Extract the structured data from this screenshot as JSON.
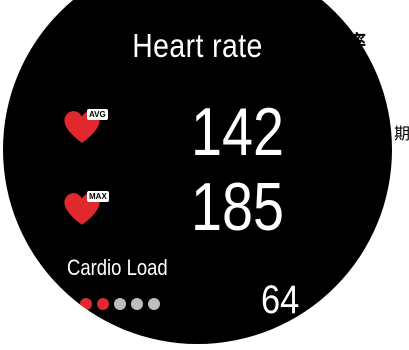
{
  "title": "Heart rate",
  "avg": {
    "tag": "AVG",
    "value": "142"
  },
  "max": {
    "tag": "MAX",
    "value": "185"
  },
  "cardio": {
    "label": "Cardio Load",
    "value": "64",
    "level": 2,
    "total": 5
  },
  "side_text": {
    "heart_rate_cn": "心率",
    "period_cn": "期"
  },
  "colors": {
    "background": "#000000",
    "heart": "#e0282d",
    "dot_active": "#e0282d",
    "dot_inactive": "#bdbdbd",
    "text": "#ffffff"
  },
  "icons": {
    "avg": "heart-icon",
    "max": "heart-icon"
  }
}
